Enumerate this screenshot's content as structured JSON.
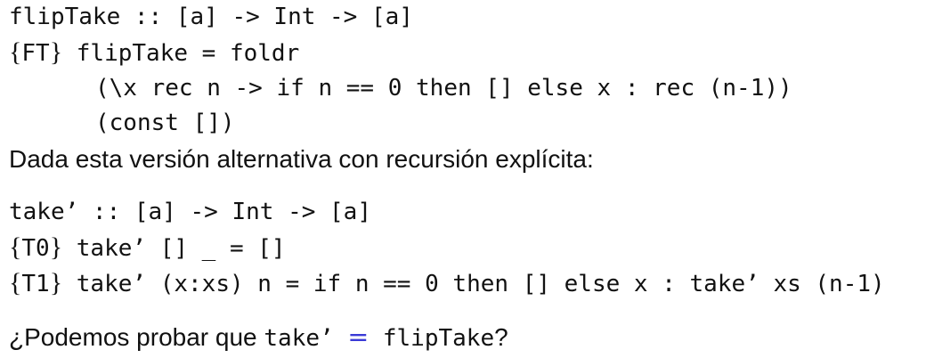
{
  "fliptake_signature": "flipTake :: [a] -> Int -> [a]",
  "ft_rule": {
    "tag": "FT",
    "code": "flipTake = foldr"
  },
  "ft_lambda": "(\\x rec n -> if n == 0 then [] else x : rec (n-1))",
  "ft_base": "(const [])",
  "explicit_intro": "Dada esta versión alternativa con recursión explícita:",
  "take_signature": "take’ :: [a] -> Int -> [a]",
  "t0_rule": {
    "tag": "T0",
    "code": "take’ [] _ = []"
  },
  "t1_rule": {
    "tag": "T1",
    "code": "take’ (x:xs) n = if n == 0 then [] else x : take’ xs (n-1)"
  },
  "question": {
    "prefix": "¿Podemos probar que ",
    "lhs": "take’",
    "equals": "=",
    "rhs": "flipTake",
    "suffix": "?"
  },
  "colors": {
    "text": "#111111",
    "equals_sign": "#3a3ad6",
    "background": "#ffffff"
  }
}
